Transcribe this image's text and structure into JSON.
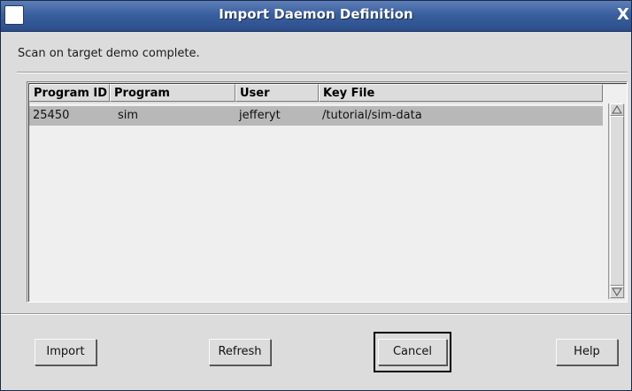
{
  "window": {
    "title": "Import Daemon Definition",
    "close_glyph": "X"
  },
  "status": "Scan on target demo complete.",
  "table": {
    "columns": [
      "Program ID",
      "Program",
      "User",
      "Key File"
    ],
    "rows": [
      [
        "25450",
        "sim",
        "jefferyt",
        "/tutorial/sim-data"
      ]
    ]
  },
  "buttons": {
    "import": "Import",
    "refresh": "Refresh",
    "cancel": "Cancel",
    "help": "Help"
  },
  "icons": {
    "window_menu": "window-menu-icon",
    "close": "close-icon",
    "scroll_up": "arrow-up-icon",
    "scroll_down": "arrow-down-icon"
  },
  "colors": {
    "titlebar": "#3a5f9e",
    "selected_row": "#b8b8b8",
    "dialog_bg": "#dcdcdc"
  }
}
